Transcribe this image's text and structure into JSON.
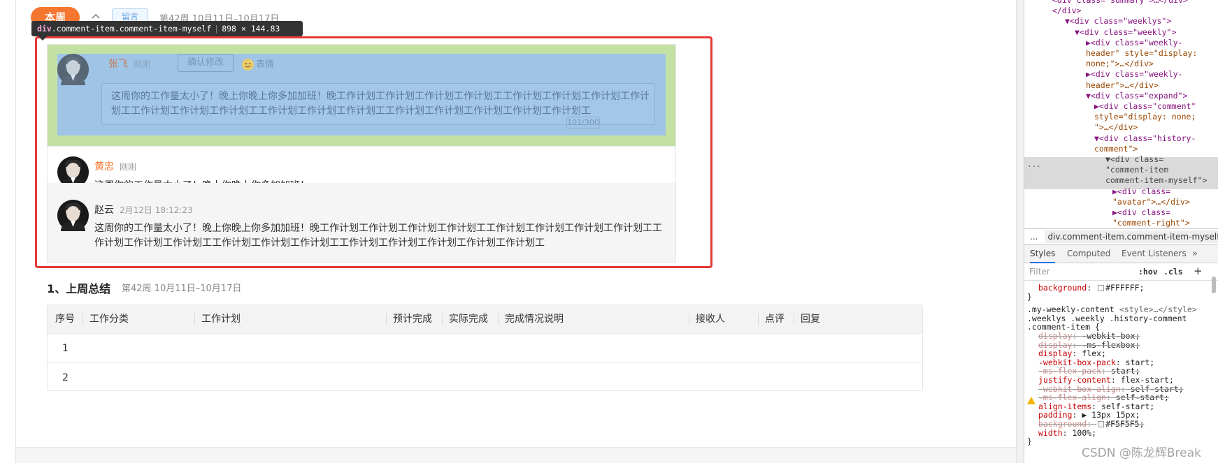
{
  "header": {
    "tab_label": "本周",
    "collapse_icon": "chevron-up-icon",
    "tag_label": "留言",
    "week_range": "第42周 10月11日–10月17日"
  },
  "inspector_tooltip": {
    "selector_tag": "div",
    "selector_classes": ".comment-item.comment-item-myself",
    "dimensions": "898 × 144.83"
  },
  "comments": [
    {
      "author": "张飞",
      "time": "刚刚",
      "confirm_button": "确认修改",
      "emoji_button": "表情",
      "textarea_value": "这周你的工作量太小了！晚上你晚上你多加加班！晚工作计划工作计划工作计划工作计划工工作计划工作计划工作计划工作计划工工作计划工作计划工作计划工工作计划工作计划工作计划工工作计划工作计划工作计划工作计划工作计划工",
      "char_counter": "101/300",
      "avatar_icon": "person-avatar-icon"
    },
    {
      "author": "黄忠",
      "time": "刚刚",
      "text": "这周你的工作量太小了！晚上你晚上你多加加班！",
      "avatar_icon": "person-avatar-icon"
    },
    {
      "author": "赵云",
      "time": "2月12日 18:12:23",
      "text": "这周你的工作量太小了！晚上你晚上你多加加班！晚工作计划工作计划工作计划工作计划工工作计划工作计划工作计划工作计划工工作计划工作计划工作计划工工作计划工作计划工作计划工工作计划工作计划工作计划工作计划工作计划工",
      "avatar_icon": "person-avatar-icon"
    }
  ],
  "section": {
    "title": "1、上周总结",
    "week_range": "第42周 10月11日–10月17日"
  },
  "table": {
    "columns": [
      "序号",
      "工作分类",
      "工作计划",
      "预计完成",
      "实际完成",
      "完成情况说明",
      "接收人",
      "点评",
      "回复"
    ],
    "rows": [
      {
        "index": "1"
      },
      {
        "index": "2"
      }
    ]
  },
  "devtools": {
    "dom_lines": [
      {
        "indent": 0,
        "text": "<div class=\"summary\">…</div>"
      },
      {
        "indent": 0,
        "text": "</div>"
      },
      {
        "indent": 1,
        "text": "▼<div class=\"weeklys\">"
      },
      {
        "indent": 2,
        "text": "▼<div class=\"weekly\">"
      },
      {
        "indent": 3,
        "text": "▶<div class=\"weekly-"
      },
      {
        "indent": 3,
        "text": "header\" style=\"display:"
      },
      {
        "indent": 3,
        "text": "none;\">…</div>"
      },
      {
        "indent": 3,
        "text": "▶<div class=\"weekly-"
      },
      {
        "indent": 3,
        "text": "header\">…</div>"
      },
      {
        "indent": 3,
        "text": "▼<div class=\"expand\">"
      },
      {
        "indent": 4,
        "text": "▶<div class=\"comment\""
      },
      {
        "indent": 4,
        "text": "style=\"display: none;"
      },
      {
        "indent": 4,
        "text": "\">…</div>"
      },
      {
        "indent": 4,
        "text": "▼<div class=\"history-"
      },
      {
        "indent": 4,
        "text": "comment\">"
      },
      {
        "indent": 5,
        "text": "▼<div class="
      },
      {
        "indent": 5,
        "text": "\"comment-item"
      },
      {
        "indent": 5,
        "text": "comment-item-myself\">"
      },
      {
        "indent": 6,
        "text": "▶<div class="
      },
      {
        "indent": 6,
        "text": "\"avatar\">…</div>"
      },
      {
        "indent": 6,
        "text": "▶<div class="
      },
      {
        "indent": 6,
        "text": "\"comment-right\">"
      }
    ],
    "breadcrumb": "div.comment-item.comment-item-myself",
    "breadcrumb_dots": "...",
    "tabs": [
      "Styles",
      "Computed",
      "Event Listeners"
    ],
    "more_icon": "double-chevron-right-icon",
    "filter_placeholder": "Filter",
    "hov": ":hov",
    "cls": ".cls",
    "add_icon": "plus-icon",
    "style_lines": [
      {
        "kind": "decl",
        "name": "background",
        "value": "#FFFFFF;",
        "struck": false,
        "swatch": true
      },
      {
        "kind": "close",
        "text": "}"
      },
      {
        "kind": "selector",
        "text": ".my-weekly-content",
        "source": "<style>…</style>"
      },
      {
        "kind": "selector",
        "text": ".weeklys .weekly .history-comment"
      },
      {
        "kind": "selector",
        "text": ".comment-item {"
      },
      {
        "kind": "decl",
        "name": "display",
        "value": "-webkit-box;",
        "struck": true
      },
      {
        "kind": "decl",
        "name": "display",
        "value": "-ms-flexbox;",
        "struck": true
      },
      {
        "kind": "decl",
        "name": "display",
        "value": "flex;",
        "struck": false
      },
      {
        "kind": "decl",
        "name": "-webkit-box-pack",
        "value": "start;",
        "struck": false
      },
      {
        "kind": "decl",
        "name": "-ms-flex-pack",
        "value": "start;",
        "struck": true
      },
      {
        "kind": "decl",
        "name": "justify-content",
        "value": "flex-start;",
        "struck": false
      },
      {
        "kind": "decl",
        "name": "-webkit-box-align",
        "value": "self-start;",
        "struck": true
      },
      {
        "kind": "decl",
        "name": "-ms-flex-align",
        "value": "self-start;",
        "struck": true
      },
      {
        "kind": "decl",
        "name": "align-items",
        "value": "self-start;",
        "struck": false
      },
      {
        "kind": "decl",
        "name": "padding",
        "value": "▶ 13px 15px;",
        "struck": false
      },
      {
        "kind": "decl",
        "name": "background",
        "value": "#F5F5F5;",
        "struck": true,
        "swatch": true
      },
      {
        "kind": "decl",
        "name": "width",
        "value": "100%;",
        "struck": false
      },
      {
        "kind": "close",
        "text": "}"
      }
    ],
    "warning_icon": "warning-triangle-icon"
  },
  "watermark": "CSDN @陈龙辉Break",
  "colors": {
    "accent_orange": "#f5762f",
    "highlight_red": "#e53935",
    "devtools_blue": "#1a73e8"
  }
}
